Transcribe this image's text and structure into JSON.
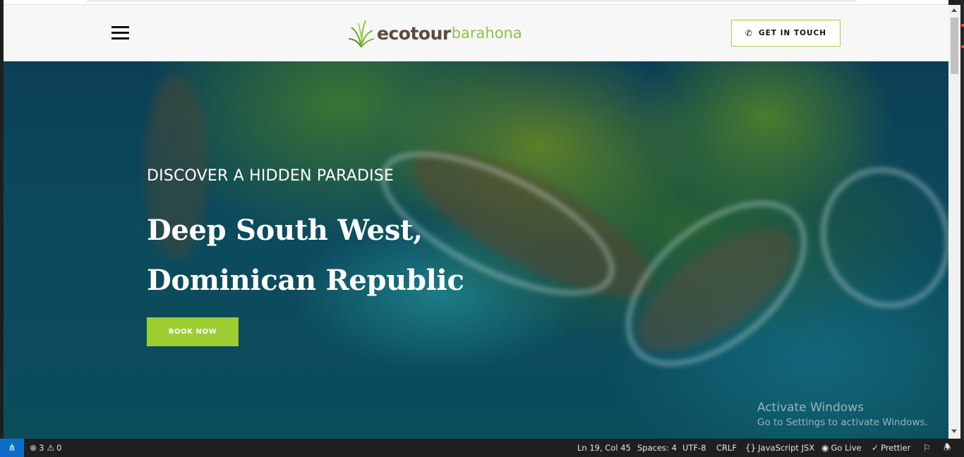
{
  "header": {
    "logo_word1": "ecotour",
    "logo_word2": "barahona",
    "cta_label": "GET IN TOUCH",
    "menu_icon": "hamburger-icon",
    "phone_icon": "phone-icon"
  },
  "hero": {
    "kicker": "DISCOVER A HIDDEN PARADISE",
    "title_line1": "Deep South West,",
    "title_line2": "Dominican Republic",
    "book_label": "BOOK NOW"
  },
  "watermark": {
    "line1": "Activate Windows",
    "line2": "Go to Settings to activate Windows."
  },
  "statusbar": {
    "remote_icon": "remote-icon",
    "errors": "3",
    "warnings": "0",
    "cursor_position": "Ln 19, Col 45",
    "indentation": "Spaces: 4",
    "encoding": "UTF-8",
    "line_ending": "CRLF",
    "language": "JavaScript JSX",
    "go_live": "Go Live",
    "prettier": "Prettier",
    "feedback_icon": "feedback-icon",
    "bell_icon": "bell-icon"
  },
  "colors": {
    "accent_green": "#9cce32",
    "logo_brown": "#5a4a3f",
    "logo_green": "#8cc43f",
    "remote_blue": "#0e6ec7"
  }
}
